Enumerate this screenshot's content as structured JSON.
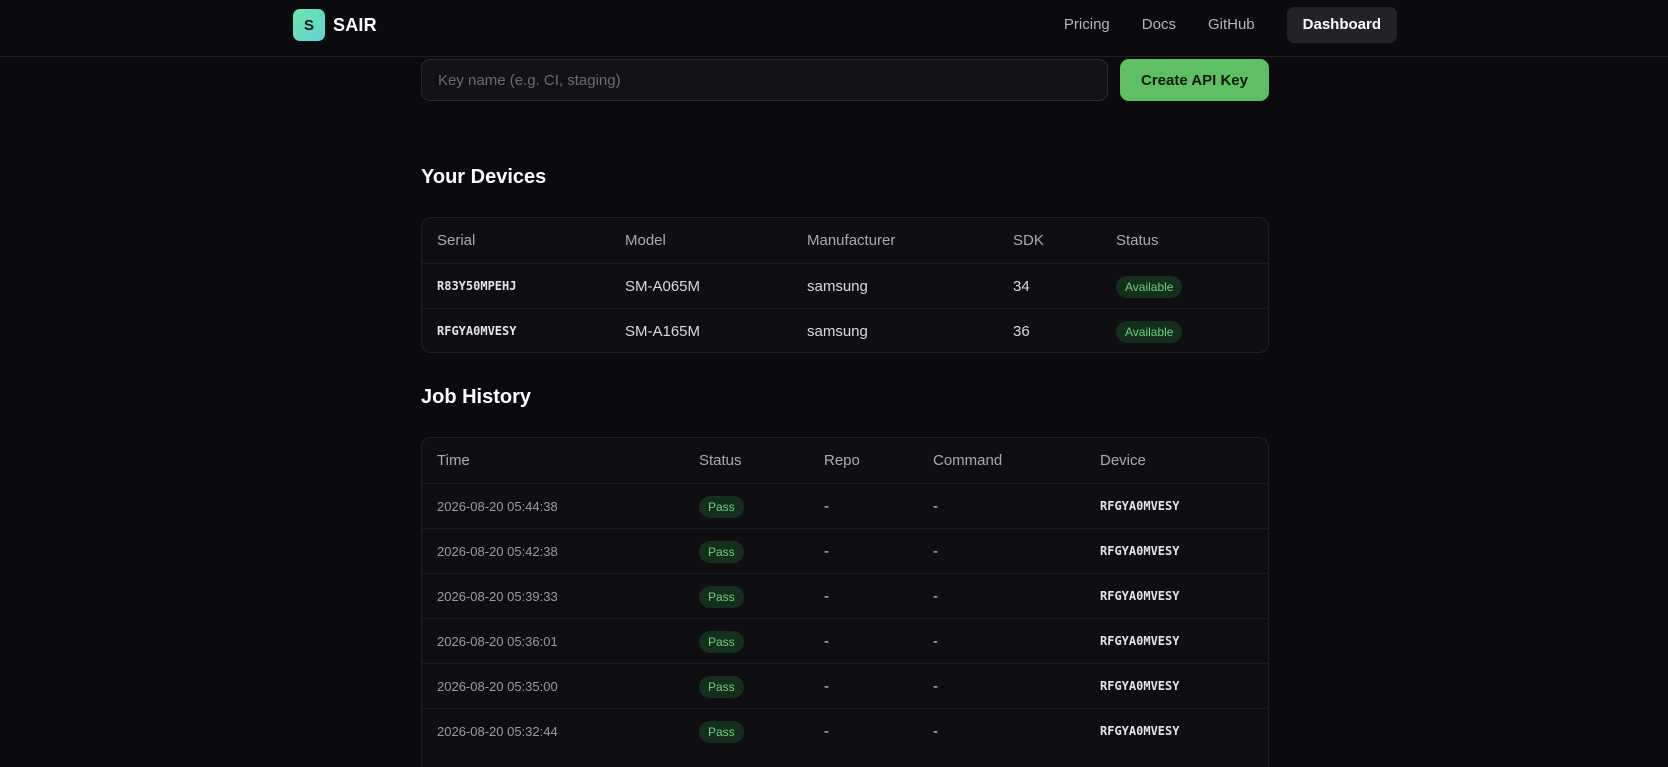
{
  "nav": {
    "logo_letter": "S",
    "brand": "SAIR",
    "links": [
      "Pricing",
      "Docs",
      "GitHub"
    ],
    "dashboard": "Dashboard"
  },
  "api_key": {
    "placeholder": "Key name (e.g. CI, staging)",
    "create_label": "Create API Key"
  },
  "devices": {
    "title": "Your Devices",
    "headers": [
      "Serial",
      "Model",
      "Manufacturer",
      "SDK",
      "Status"
    ],
    "rows": [
      {
        "serial": "R83Y50MPEHJ",
        "model": "SM-A065M",
        "manufacturer": "samsung",
        "sdk": "34",
        "status": "Available"
      },
      {
        "serial": "RFGYA0MVESY",
        "model": "SM-A165M",
        "manufacturer": "samsung",
        "sdk": "36",
        "status": "Available"
      }
    ]
  },
  "jobs": {
    "title": "Job History",
    "headers": [
      "Time",
      "Status",
      "Repo",
      "Command",
      "Device"
    ],
    "rows": [
      {
        "time": "2026-08-20 05:44:38",
        "status": "Pass",
        "repo": "-",
        "command": "-",
        "device": "RFGYA0MVESY"
      },
      {
        "time": "2026-08-20 05:42:38",
        "status": "Pass",
        "repo": "-",
        "command": "-",
        "device": "RFGYA0MVESY"
      },
      {
        "time": "2026-08-20 05:39:33",
        "status": "Pass",
        "repo": "-",
        "command": "-",
        "device": "RFGYA0MVESY"
      },
      {
        "time": "2026-08-20 05:36:01",
        "status": "Pass",
        "repo": "-",
        "command": "-",
        "device": "RFGYA0MVESY"
      },
      {
        "time": "2026-08-20 05:35:00",
        "status": "Pass",
        "repo": "-",
        "command": "-",
        "device": "RFGYA0MVESY"
      },
      {
        "time": "2026-08-20 05:32:44",
        "status": "Pass",
        "repo": "-",
        "command": "-",
        "device": "RFGYA0MVESY"
      }
    ]
  },
  "colors": {
    "background": "#0b0b0f",
    "accent": "#5fbf64",
    "badge_bg": "#14301c",
    "badge_text": "#6fd07a"
  }
}
